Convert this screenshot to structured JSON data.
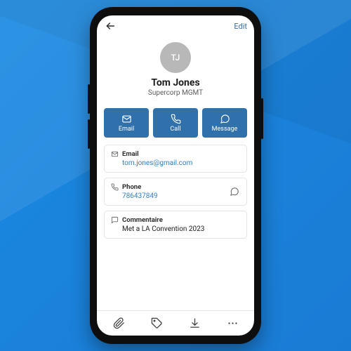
{
  "header": {
    "edit_label": "Edit"
  },
  "profile": {
    "initials": "TJ",
    "name": "Tom Jones",
    "company": "Supercorp MGMT"
  },
  "actions": {
    "email": "Email",
    "call": "Call",
    "message": "Message"
  },
  "fields": {
    "email": {
      "label": "Email",
      "value": "tom.jones@gmail.com"
    },
    "phone": {
      "label": "Phone",
      "value": "786437849"
    },
    "comment": {
      "label": "Commentaire",
      "value": "Met a LA Convention 2023"
    }
  },
  "colors": {
    "accent": "#3070ab",
    "link": "#2f7dca"
  }
}
